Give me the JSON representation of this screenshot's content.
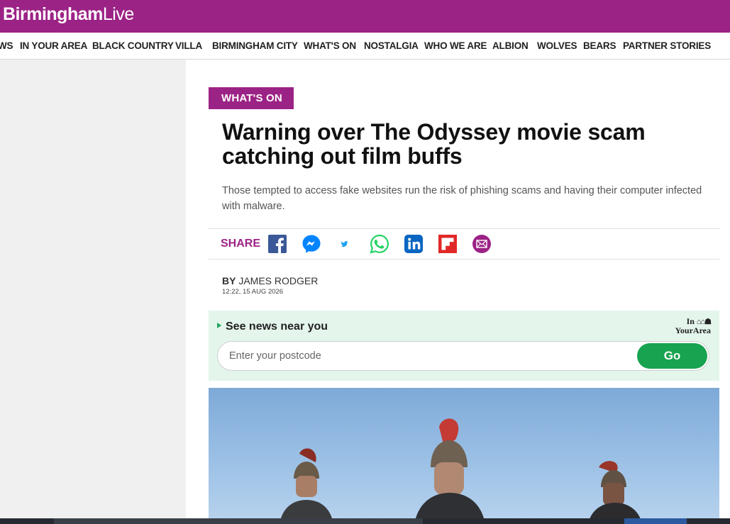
{
  "site": {
    "logo_bold": "Birmingham",
    "logo_light": "Live",
    "brand_color": "#9c2386"
  },
  "nav": {
    "items": [
      {
        "label": "WS"
      },
      {
        "label": "IN YOUR AREA"
      },
      {
        "label": "BLACK COUNTRY"
      },
      {
        "label": "VILLA"
      },
      {
        "label": "BIRMINGHAM CITY"
      },
      {
        "label": "WHAT'S ON"
      },
      {
        "label": "NOSTALGIA"
      },
      {
        "label": "WHO WE ARE"
      },
      {
        "label": "ALBION"
      },
      {
        "label": "WOLVES"
      },
      {
        "label": "BEARS"
      },
      {
        "label": "PARTNER STORIES"
      }
    ]
  },
  "article": {
    "section": "WHAT'S ON",
    "headline": "Warning over The Odyssey movie scam catching out film buffs",
    "standfirst": "Those tempted to access fake websites run the risk of phishing scams and having their computer infected with malware.",
    "byline_prefix": "BY",
    "author": "JAMES RODGER",
    "timestamp": "12:22, 15 AUG 2026"
  },
  "share": {
    "label": "SHARE",
    "icons": [
      {
        "name": "facebook-icon",
        "color": "#3b5998"
      },
      {
        "name": "messenger-icon",
        "color": "#0084ff"
      },
      {
        "name": "twitter-icon",
        "color": "#1da1f2"
      },
      {
        "name": "whatsapp-icon",
        "color": "#25d366"
      },
      {
        "name": "linkedin-icon",
        "color": "#0a66c2"
      },
      {
        "name": "flipboard-icon",
        "color": "#e12828"
      },
      {
        "name": "email-icon",
        "color": "#9c2386"
      }
    ]
  },
  "in_your_area": {
    "title": "See news near you",
    "logo_top": "In",
    "logo_bottom": "YourArea",
    "postcode_placeholder": "Enter your postcode",
    "go_label": "Go",
    "accent": "#17a34f"
  }
}
